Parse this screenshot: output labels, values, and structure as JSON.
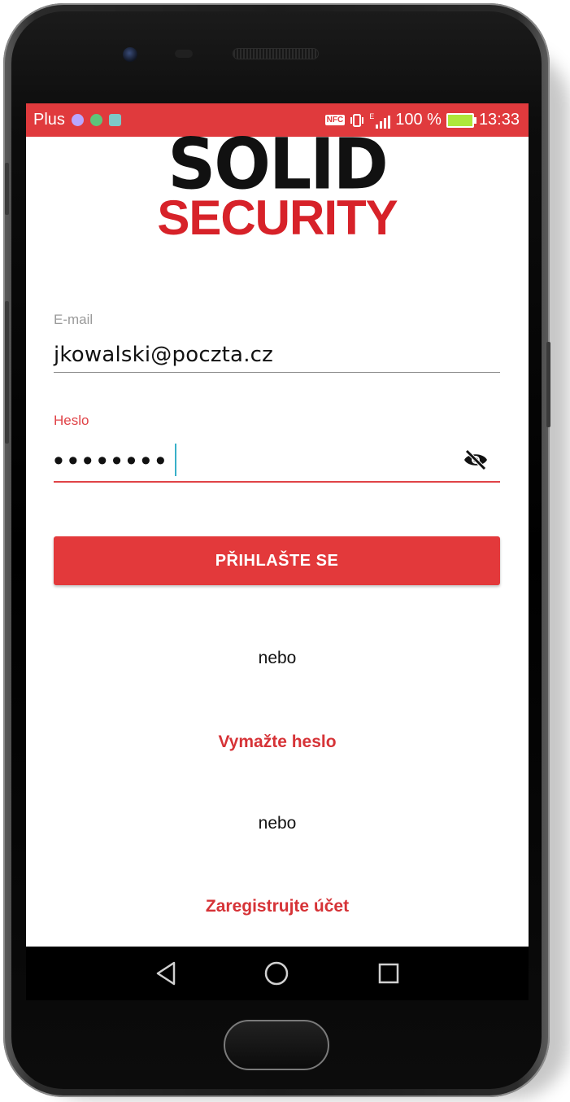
{
  "status_bar": {
    "carrier": "Plus",
    "nfc_label": "NFC",
    "network_type": "E",
    "battery": "100 %",
    "time": "13:33",
    "notification_icons": [
      "location-icon",
      "globe-icon",
      "android-icon"
    ]
  },
  "logo": {
    "line1": "SOLID",
    "line2": "SECURITY"
  },
  "email": {
    "label": "E-mail",
    "value": "jkowalski@poczta.cz"
  },
  "password": {
    "label": "Heslo",
    "masked_value": "••••••••"
  },
  "login_button": "PŘIHLAŠTE SE",
  "or_text_1": "nebo",
  "reset_password_link": "Vymažte heslo",
  "or_text_2": "nebo",
  "register_link": "Zaregistrujte účet",
  "colors": {
    "accent": "#e3393b",
    "status_bar": "#e03a3d",
    "link": "#d63337",
    "logo_red": "#d72229"
  }
}
